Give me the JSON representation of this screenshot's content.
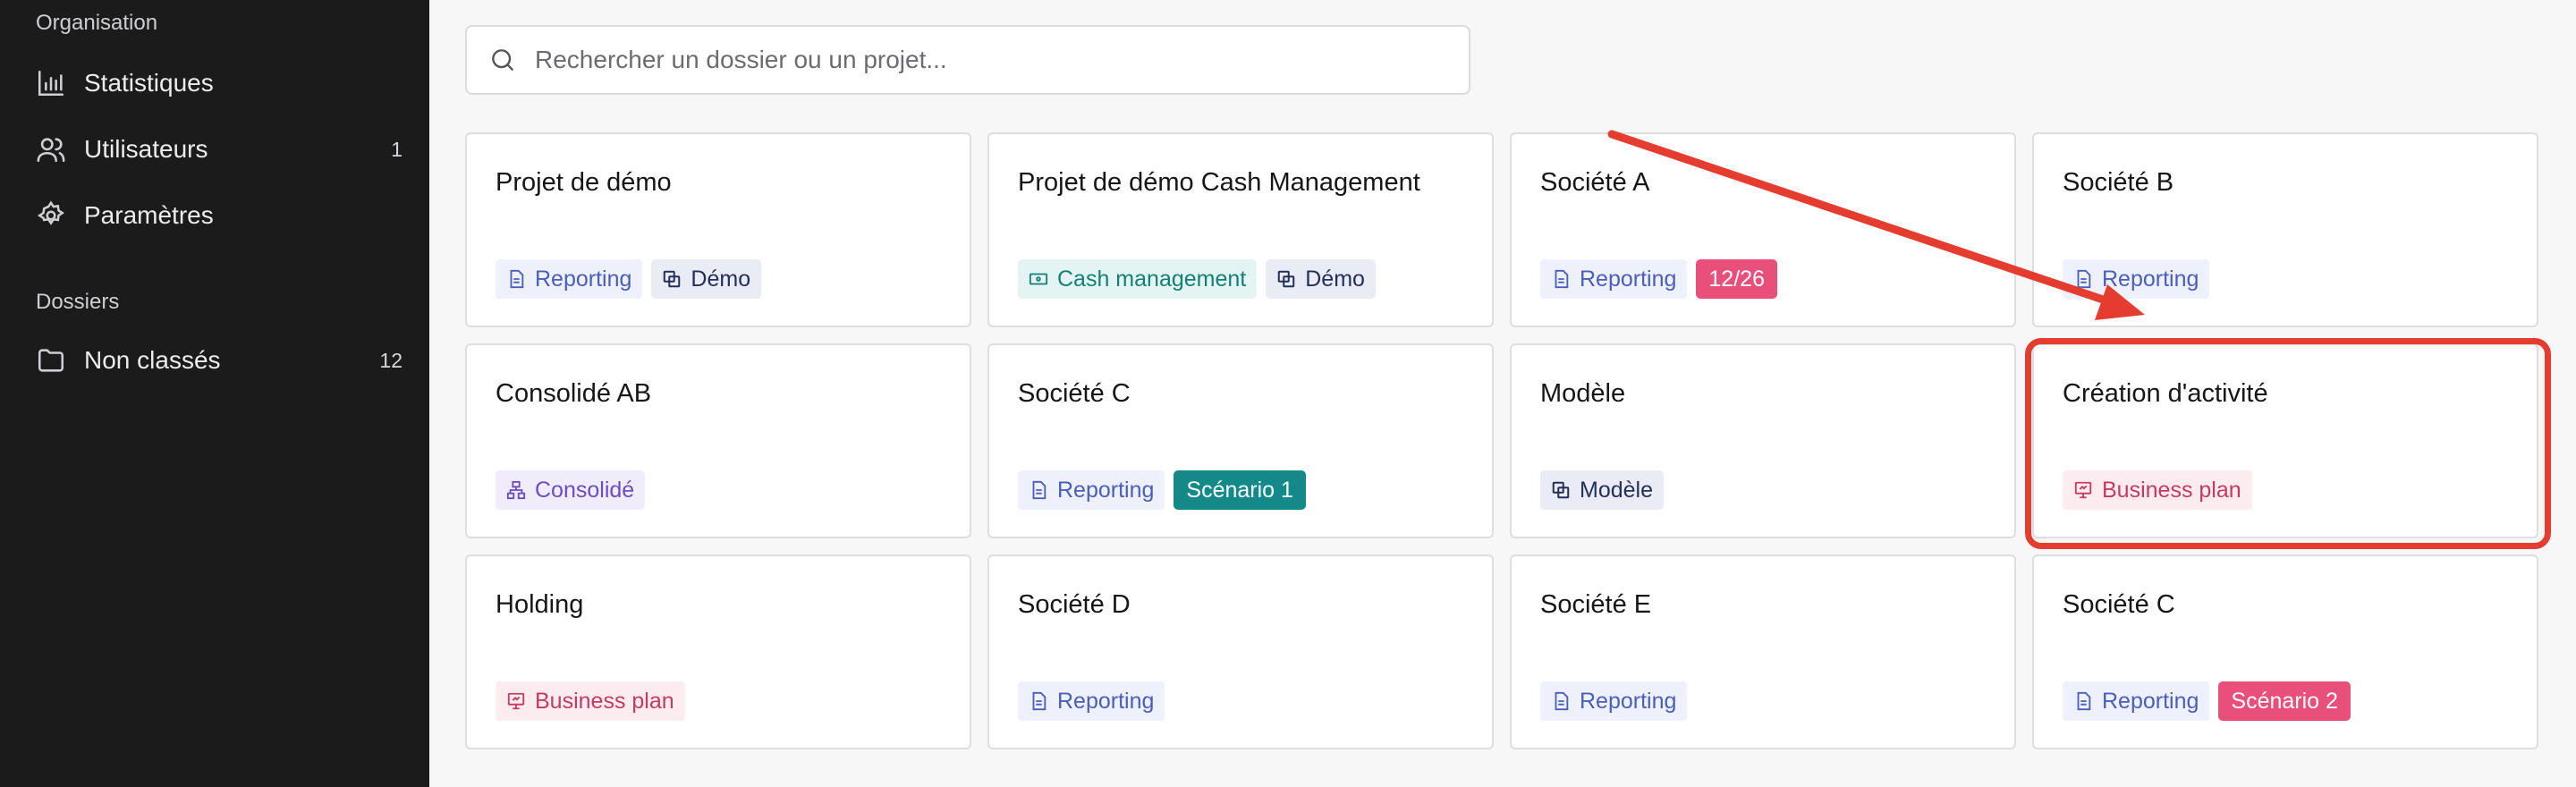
{
  "sidebar": {
    "org_label": "Organisation",
    "items": [
      {
        "label": "Statistiques",
        "count": ""
      },
      {
        "label": "Utilisateurs",
        "count": "1"
      },
      {
        "label": "Paramètres",
        "count": ""
      }
    ],
    "folders_label": "Dossiers",
    "folders": [
      {
        "label": "Non classés",
        "count": "12"
      }
    ]
  },
  "search": {
    "placeholder": "Rechercher un dossier ou un projet..."
  },
  "projects": [
    {
      "title": "Projet de démo",
      "badges": [
        {
          "label": "Reporting"
        },
        {
          "label": "Démo"
        }
      ]
    },
    {
      "title": "Projet de démo Cash Management",
      "badges": [
        {
          "label": "Cash management"
        },
        {
          "label": "Démo"
        }
      ]
    },
    {
      "title": "Société A",
      "badges": [
        {
          "label": "Reporting"
        },
        {
          "label": "12/26"
        }
      ]
    },
    {
      "title": "Société B",
      "badges": [
        {
          "label": "Reporting"
        }
      ]
    },
    {
      "title": "Consolidé AB",
      "badges": [
        {
          "label": "Consolidé"
        }
      ]
    },
    {
      "title": "Société C",
      "badges": [
        {
          "label": "Reporting"
        },
        {
          "label": "Scénario 1"
        }
      ]
    },
    {
      "title": "Modèle",
      "badges": [
        {
          "label": "Modèle"
        }
      ]
    },
    {
      "title": "Création d'activité",
      "badges": [
        {
          "label": "Business plan"
        }
      ]
    },
    {
      "title": "Holding",
      "badges": [
        {
          "label": "Business plan"
        }
      ]
    },
    {
      "title": "Société D",
      "badges": [
        {
          "label": "Reporting"
        }
      ]
    },
    {
      "title": "Société E",
      "badges": [
        {
          "label": "Reporting"
        }
      ]
    },
    {
      "title": "Société C",
      "badges": [
        {
          "label": "Reporting"
        },
        {
          "label": "Scénario 2"
        }
      ]
    }
  ],
  "annotation": {
    "color": "#e43d30"
  }
}
